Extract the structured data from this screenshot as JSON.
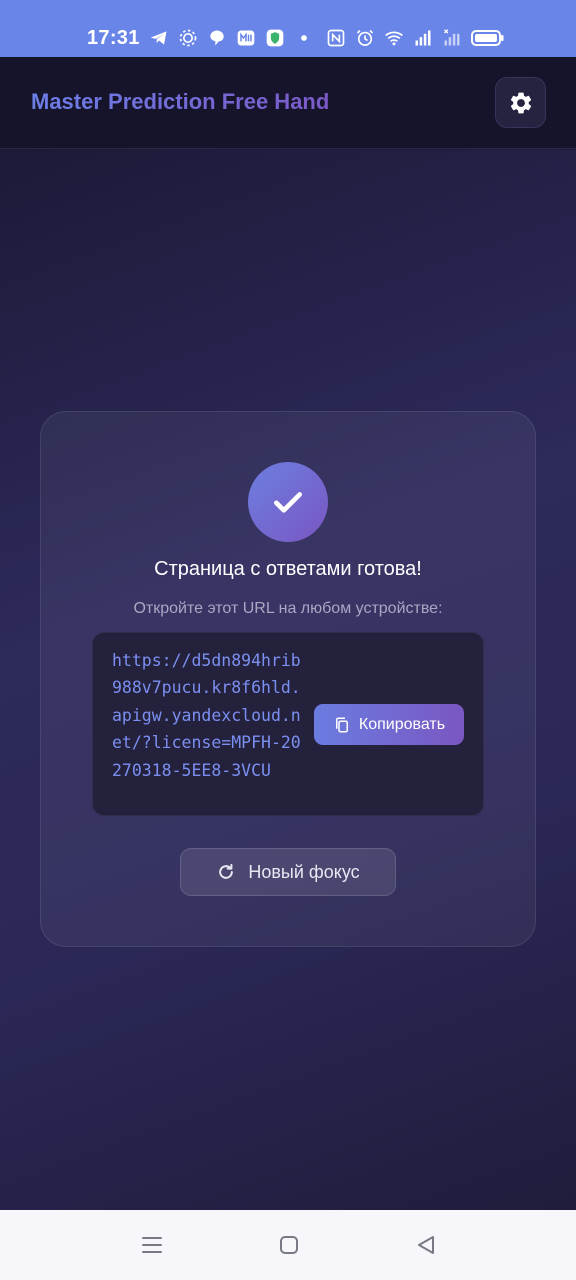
{
  "status_bar": {
    "time": "17:31",
    "left_icons": [
      "telegram-icon",
      "sun-settings-icon",
      "assistant-icon",
      "app-m-icon",
      "shield-icon",
      "dot-icon"
    ],
    "right_icons": [
      "nfc-icon",
      "alarm-icon",
      "wifi-icon",
      "signal-icon",
      "signal-x-icon",
      "battery-icon"
    ]
  },
  "header": {
    "title": "Master Prediction Free Hand",
    "settings_icon": "gear-icon"
  },
  "card": {
    "title": "Страница с ответами готова!",
    "subtitle": "Откройте этот URL на любом устройстве:",
    "url": "https://d5dn894hrib988v7pucu.kr8f6hld.apigw.yandexcloud.net/?license=MPFH-20270318-5EE8-3VCU",
    "copy_label": "Копировать",
    "new_focus_label": "Новый фокус"
  },
  "colors": {
    "accent_start": "#6b7fe6",
    "accent_end": "#7a56c2",
    "url_text": "#7b8ff0",
    "status_bar": "#6a85e8"
  },
  "nav": {
    "icons": [
      "menu-icon",
      "home-square-icon",
      "back-triangle-icon"
    ]
  }
}
